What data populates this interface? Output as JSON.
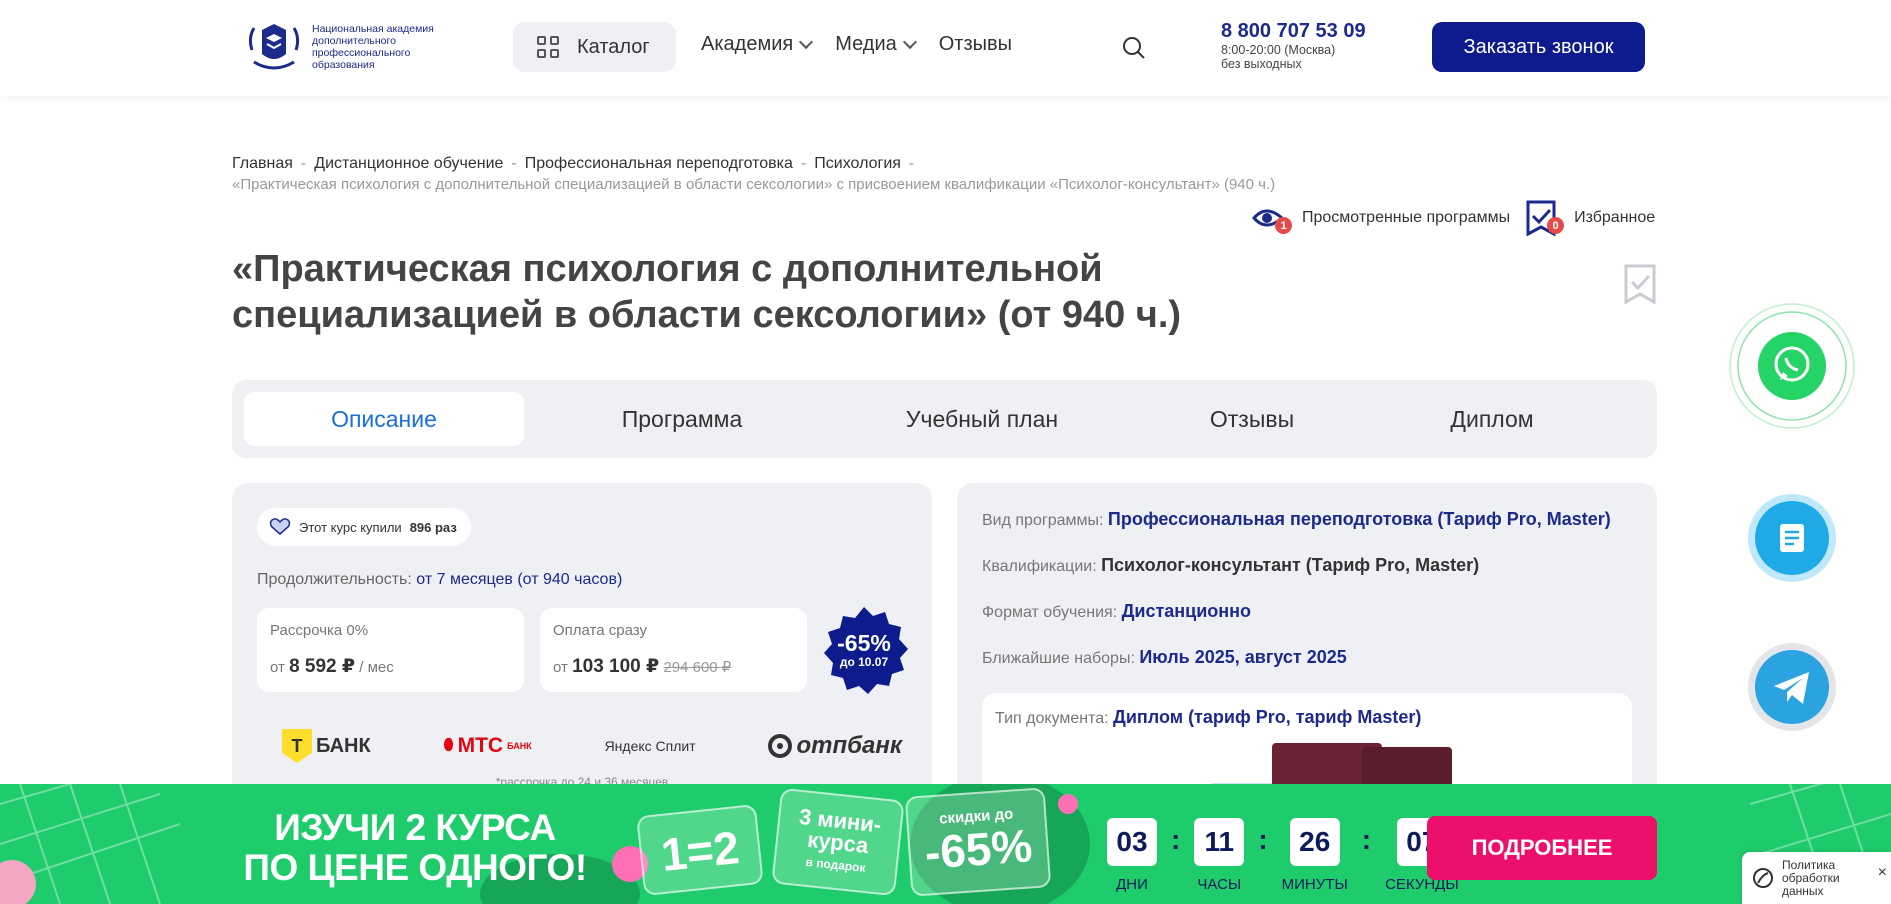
{
  "header": {
    "logo_text": "Национальная академия дополнительного профессионального образования",
    "catalog_label": "Каталог",
    "nav": [
      {
        "label": "Академия"
      },
      {
        "label": "Медиа"
      },
      {
        "label": "Отзывы"
      }
    ],
    "phone": "8 800 707 53 09",
    "hours": "8:00-20:00 (Москва)",
    "days": "без выходных",
    "call_label": "Заказать звонок"
  },
  "breadcrumb": {
    "items": [
      "Главная",
      "Дистанционное обучение",
      "Профессиональная переподготовка",
      "Психология"
    ],
    "current": "«Практическая психология с дополнительной специализацией в области сексологии» с присвоением квалификации «Психолог-консультант» (940 ч.)"
  },
  "history": {
    "viewed_label": "Просмотренные программы",
    "viewed_count": "1",
    "favorites_label": "Избранное",
    "favorites_count": "0"
  },
  "title": "«Практическая психология с дополнительной специализацией в области сексологии» (от 940 ч.)",
  "tabs": [
    {
      "label": "Описание",
      "active": true
    },
    {
      "label": "Программа"
    },
    {
      "label": "Учебный план"
    },
    {
      "label": "Отзывы"
    },
    {
      "label": "Диплом"
    }
  ],
  "course": {
    "bought_prefix": "Этот курс купили",
    "bought_count": "896 раз",
    "duration_label": "Продолжительность:",
    "duration_value": "от 7 месяцев (от 940 часов)",
    "installment_label": "Рассрочка 0%",
    "installment_from": "от",
    "installment_price": "8 592 ₽",
    "installment_suffix": "/ мес",
    "full_label": "Оплата сразу",
    "full_from": "от",
    "full_price": "103 100 ₽",
    "full_old_price": "294 600 ₽",
    "discount": "-65%",
    "discount_until": "до 10.07",
    "banks": {
      "tbank": "БАНК",
      "tbank_letter": "Т",
      "mts": "МТС",
      "mts_sub": "БАНК",
      "yandex": "Яндекс Сплит",
      "otp": "отпбанк"
    },
    "installment_note": "*рассрочка до 24 и 36 месяцев"
  },
  "info": {
    "program_type_label": "Вид программы:",
    "program_type": "Профессиональная переподготовка (Тариф Pro, Master)",
    "qualification_label": "Квалификации:",
    "qualification": "Психолог-консультант (Тариф Pro, Master)",
    "format_label": "Формат обучения:",
    "format": "Дистанционно",
    "intake_label": "Ближайшие наборы:",
    "intake": "Июль 2025, август 2025",
    "doc_label": "Тип документа:",
    "doc": "Диплом (тариф Pro, тариф Master)"
  },
  "promo": {
    "line1": "ИЗУЧИ 2 КУРСА",
    "line2": "ПО ЦЕНЕ ОДНОГО!",
    "card1": "1=2",
    "card2_line1": "3 мини-",
    "card2_line2": "курса",
    "card2_line3": "в подарок",
    "card3_line1": "скидки до",
    "card3_line2": "-65%",
    "timer": [
      {
        "value": "03",
        "label": "ДНИ"
      },
      {
        "value": "11",
        "label": "ЧАСЫ"
      },
      {
        "value": "26",
        "label": "МИНУТЫ"
      },
      {
        "value": "07",
        "label": "СЕКУНДЫ"
      }
    ],
    "button": "ПОДРОБНЕЕ"
  },
  "policy": {
    "text_1": "Политика",
    "text_2": "обработки",
    "text_3": "данных",
    "close": "×"
  },
  "colors": {
    "brand_blue": "#1c2a8c",
    "button_navy": "#0d1b8c",
    "promo_green": "#1fcc6c",
    "promo_pink": "#ec0f6b",
    "whatsapp": "#25d366",
    "telegram": "#2aa3e0"
  }
}
